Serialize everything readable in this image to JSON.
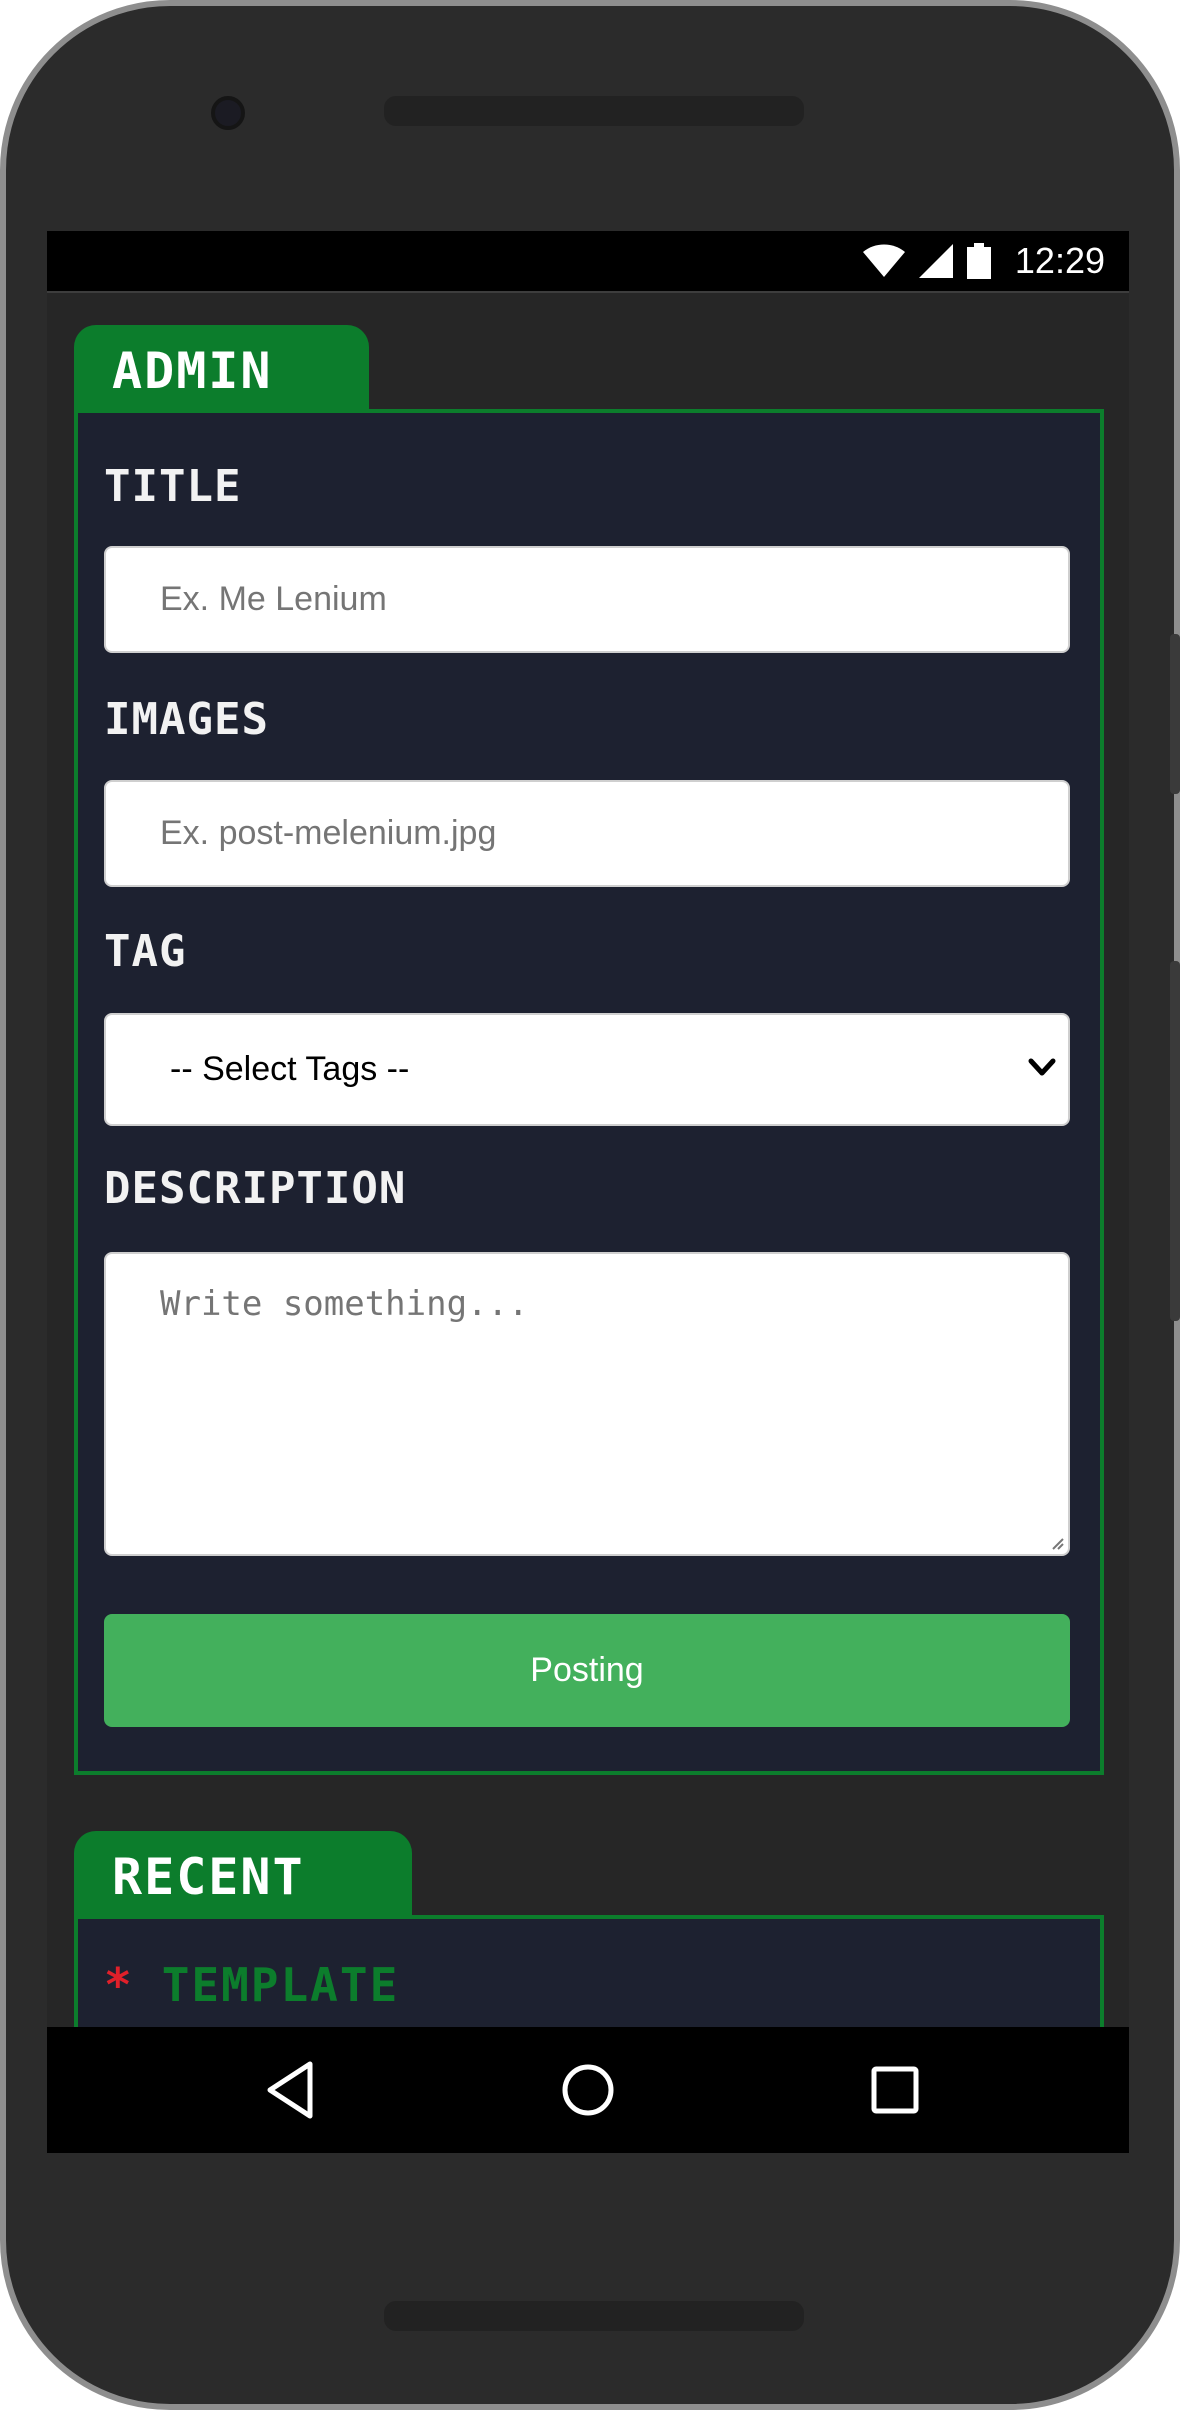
{
  "statusbar": {
    "time": "12:29",
    "icons": [
      "wifi-icon",
      "signal-icon",
      "battery-icon"
    ]
  },
  "admin": {
    "tab_label": "ADMIN",
    "title_label": "TITLE",
    "title_placeholder": "Ex. Me Lenium",
    "images_label": "IMAGES",
    "images_placeholder": "Ex. post-melenium.jpg",
    "tag_label": "TAG",
    "tag_selected": "-- Select Tags --",
    "description_label": "DESCRIPTION",
    "description_placeholder": "Write something...",
    "submit_label": "Posting"
  },
  "recent": {
    "tab_label": "RECENT",
    "items": [
      {
        "bullet": "*",
        "label": "TEMPLATE"
      }
    ]
  },
  "navbar": {
    "icons": [
      "back-icon",
      "home-icon",
      "recents-icon"
    ]
  },
  "colors": {
    "accent_green": "#0c7d2c",
    "button_green": "#43b05c",
    "panel_bg": "#1d2130",
    "bullet_red": "#e0202a"
  }
}
